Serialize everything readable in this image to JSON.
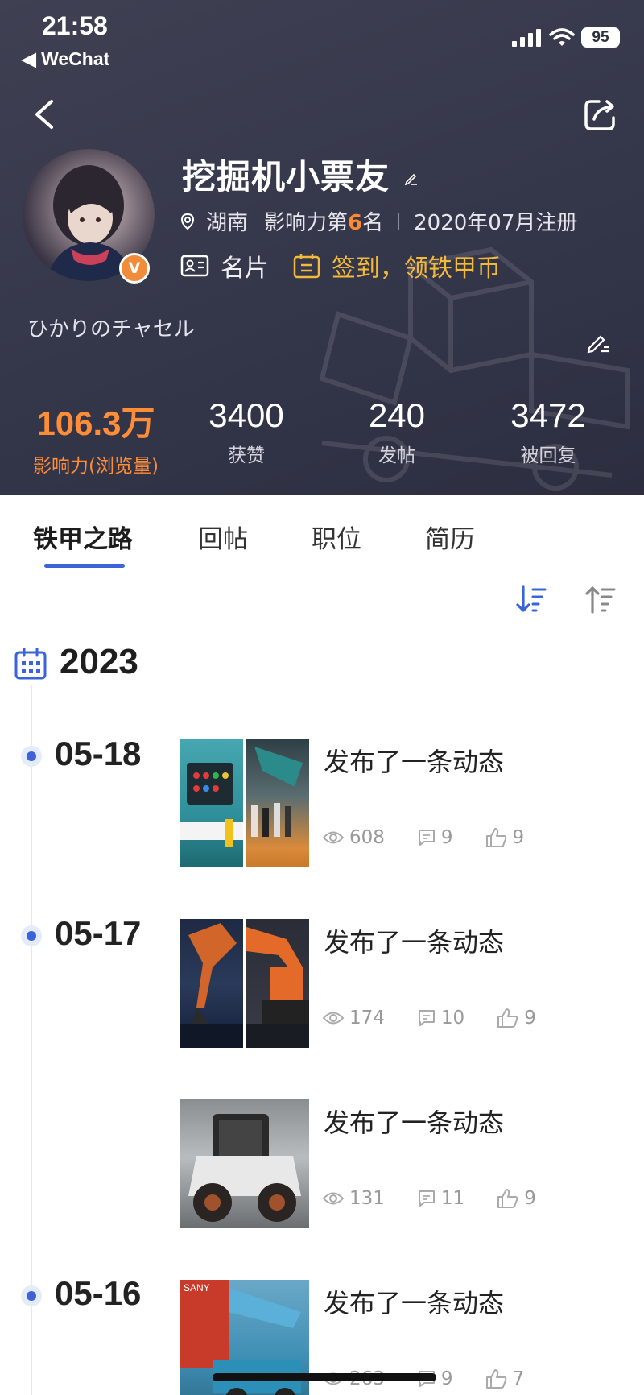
{
  "status_bar": {
    "time": "21:58",
    "back_app": "◀ WeChat",
    "battery": "95"
  },
  "profile": {
    "name": "挖掘机小票友",
    "location": "湖南",
    "influence_rank_prefix": "影响力第",
    "influence_rank": "6",
    "influence_rank_suffix": "名",
    "registered": "2020年07月注册",
    "card_label": "名片",
    "checkin_label": "签到，领铁甲币",
    "signature": "ひかりのチャセル",
    "badge": "V"
  },
  "stats": [
    {
      "value": "106.3万",
      "label": "影响力(浏览量)"
    },
    {
      "value": "3400",
      "label": "获赞"
    },
    {
      "value": "240",
      "label": "发帖"
    },
    {
      "value": "3472",
      "label": "被回复"
    }
  ],
  "tabs": [
    {
      "label": "铁甲之路",
      "active": true
    },
    {
      "label": "回帖",
      "active": false
    },
    {
      "label": "职位",
      "active": false
    },
    {
      "label": "简历",
      "active": false
    }
  ],
  "timeline": {
    "year": "2023",
    "dates": [
      "05-18",
      "05-17",
      "05-16"
    ],
    "posts": [
      {
        "title": "发布了一条动态",
        "views": "608",
        "comments": "9",
        "likes": "9"
      },
      {
        "title": "发布了一条动态",
        "views": "174",
        "comments": "10",
        "likes": "9"
      },
      {
        "title": "发布了一条动态",
        "views": "131",
        "comments": "11",
        "likes": "9"
      },
      {
        "title": "发布了一条动态",
        "views": "263",
        "comments": "9",
        "likes": "7"
      }
    ]
  },
  "colors": {
    "accent_blue": "#3a64d8",
    "influence_orange": "#ff8c36",
    "checkin_gold": "#f5b93a",
    "header_bg": "#3a3c4e"
  }
}
